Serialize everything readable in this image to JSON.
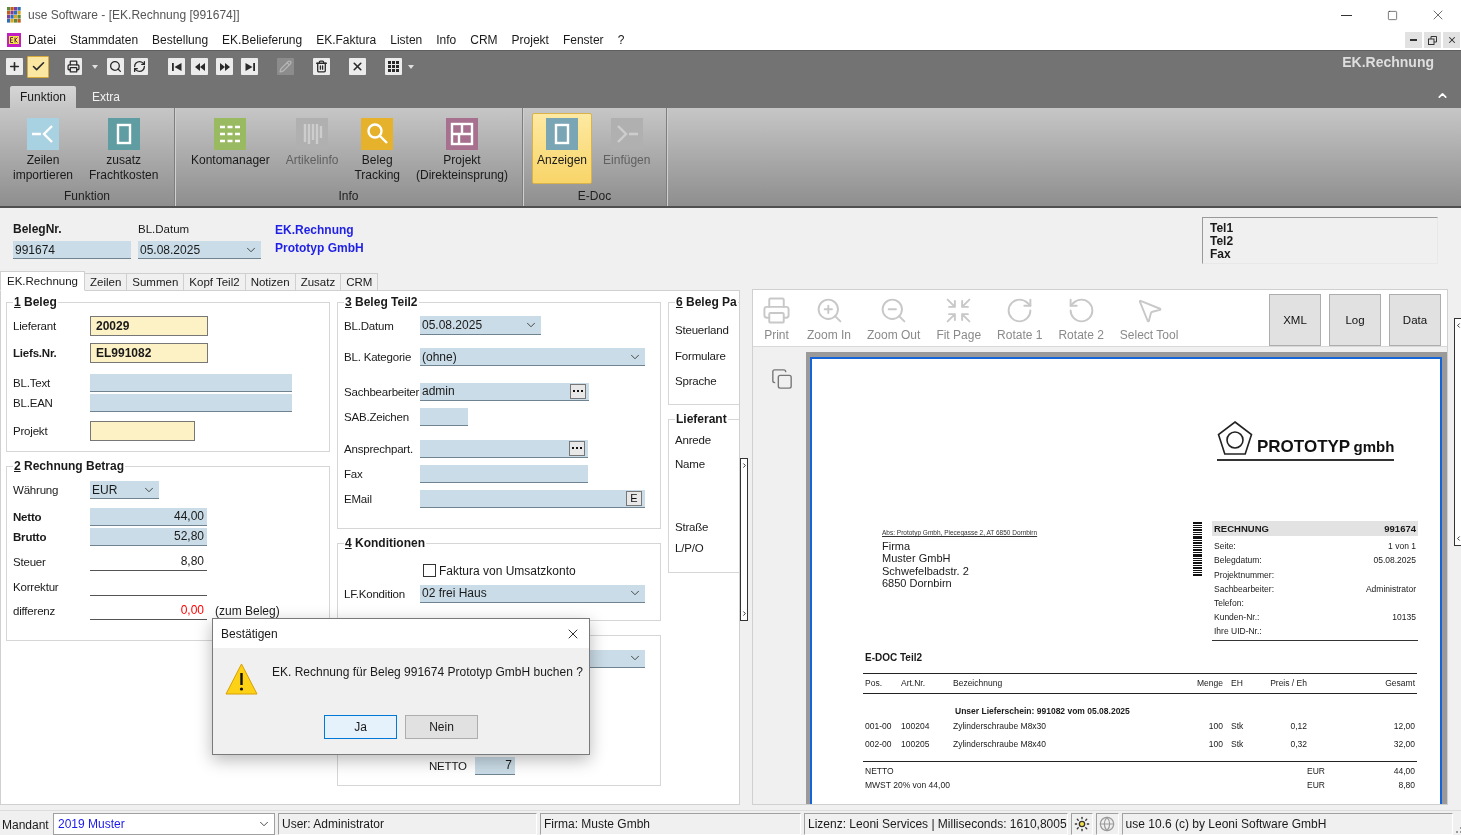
{
  "window": {
    "title": "use Software - [EK.Rechnung [991674]]"
  },
  "menu": {
    "items": [
      "Datei",
      "Stammdaten",
      "Bestellung",
      "EK.Belieferung",
      "EK.Faktura",
      "Listen",
      "Info",
      "CRM",
      "Projekt",
      "Fenster",
      "?"
    ]
  },
  "toolbar": {
    "buttons": [
      {
        "kind": "add",
        "pressed": false,
        "disabled": false
      },
      {
        "kind": "confirm",
        "pressed": true,
        "disabled": false
      },
      {
        "kind": "print",
        "pressed": false,
        "disabled": false
      },
      {
        "kind": "dropdown",
        "pressed": false,
        "disabled": false
      },
      {
        "kind": "search",
        "pressed": false,
        "disabled": false
      },
      {
        "kind": "refresh",
        "pressed": false,
        "disabled": false
      },
      {
        "kind": "first",
        "pressed": false,
        "disabled": false
      },
      {
        "kind": "previous",
        "pressed": false,
        "disabled": false
      },
      {
        "kind": "next",
        "pressed": false,
        "disabled": false
      },
      {
        "kind": "last",
        "pressed": false,
        "disabled": false
      },
      {
        "kind": "edit",
        "pressed": false,
        "disabled": true
      },
      {
        "kind": "delete",
        "pressed": false,
        "disabled": false
      },
      {
        "kind": "cancel",
        "pressed": false,
        "disabled": false
      },
      {
        "kind": "grid",
        "pressed": false,
        "disabled": false
      },
      {
        "kind": "dropdown",
        "pressed": false,
        "disabled": false
      }
    ],
    "module_title": "EK.Rechnung"
  },
  "ribbon": {
    "tabs": [
      {
        "label": "Funktion",
        "selected": true
      },
      {
        "label": "Extra",
        "selected": false
      }
    ],
    "groups": [
      {
        "label": "Funktion",
        "buttons": [
          {
            "kind": "import",
            "label": "Zeilen importieren",
            "selected": false,
            "disabled": false
          },
          {
            "kind": "freight",
            "label": "zusatz Frachtkosten",
            "selected": false,
            "disabled": false
          }
        ]
      },
      {
        "label": "Info",
        "buttons": [
          {
            "kind": "accounts",
            "label": "Kontomanager",
            "selected": false,
            "disabled": false
          },
          {
            "kind": "article",
            "label": "Artikelinfo",
            "selected": false,
            "disabled": true
          },
          {
            "kind": "tracking",
            "label": "Beleg Tracking",
            "selected": false,
            "disabled": false
          },
          {
            "kind": "project",
            "label": "Projekt (Direkteinsprung)",
            "selected": false,
            "disabled": false
          }
        ]
      },
      {
        "label": "E-Doc",
        "buttons": [
          {
            "kind": "display",
            "label": "Anzeigen",
            "selected": true,
            "disabled": false
          },
          {
            "kind": "insert",
            "label": "Einfügen",
            "selected": false,
            "disabled": true
          }
        ]
      }
    ]
  },
  "header": {
    "beleg_nr": {
      "label": "BelegNr.",
      "value": "991674"
    },
    "bl_datum": {
      "label": "BL.Datum",
      "value": "05.08.2025"
    },
    "document_type": "EK.Rechnung",
    "supplier": "Prototyp GmbH",
    "contact_labels": [
      "Tel1",
      "Tel2",
      "Fax"
    ]
  },
  "form": {
    "tabs": [
      {
        "label": "EK.Rechnung",
        "selected": true
      },
      {
        "label": "Zeilen",
        "selected": false
      },
      {
        "label": "Summen",
        "selected": false
      },
      {
        "label": "Kopf Teil2",
        "selected": false
      },
      {
        "label": "Notizen",
        "selected": false
      },
      {
        "label": "Zusatz",
        "selected": false
      },
      {
        "label": "CRM",
        "selected": false
      }
    ],
    "beleg": {
      "number": "1",
      "title": "Beleg",
      "fields": [
        {
          "kind": "required",
          "label": "Lieferant",
          "value": "20029"
        },
        {
          "kind": "required",
          "label": "Liefs.Nr.",
          "value": "EL991082"
        },
        {
          "kind": "input",
          "label": "BL.Text"
        },
        {
          "kind": "input",
          "label": "BL.EAN"
        },
        {
          "kind": "required",
          "label": "Projekt"
        }
      ]
    },
    "rechnung_betrag": {
      "number": "2",
      "title": "Rechnung Betrag",
      "fields": [
        {
          "kind": "dropdown",
          "label": "Währung",
          "value": "EUR"
        },
        {
          "kind": "input",
          "label": "Netto",
          "value": "44,00"
        },
        {
          "kind": "input",
          "label": "Brutto",
          "value": "52,80"
        },
        {
          "kind": "line",
          "label": "Steuer",
          "value": "8,80"
        },
        {
          "kind": "line",
          "label": "Korrektur"
        },
        {
          "kind": "line",
          "label": "differenz",
          "value": "0,00",
          "note": "(zum Beleg)"
        }
      ]
    },
    "beleg_teil2": {
      "number": "3",
      "title": "Beleg Teil2",
      "fields": [
        {
          "kind": "dropdown",
          "label": "BL.Datum",
          "value": "05.08.2025"
        },
        {
          "kind": "dropdown",
          "label": "BL. Kategorie",
          "value": "(ohne)"
        },
        {
          "kind": "lookup",
          "label": "Sachbearbeiter",
          "value": "admin"
        },
        {
          "kind": "input",
          "label": "SAB.Zeichen"
        },
        {
          "kind": "lookup",
          "label": "Ansprechpart."
        },
        {
          "kind": "input",
          "label": "Fax"
        },
        {
          "kind": "email",
          "label": "EMail",
          "button": "E"
        }
      ]
    },
    "konditionen": {
      "number": "4",
      "title": "Konditionen",
      "fields": [
        {
          "kind": "checkbox",
          "label": "Faktura von Umsatzkonto",
          "checked": false
        },
        {
          "kind": "dropdown",
          "label": "LF.Kondition",
          "value": "02 frei Haus"
        }
      ]
    },
    "section_5": {
      "fields": [
        {
          "kind": "dropdown"
        },
        {
          "kind": "input",
          "label": "NETTO",
          "value": "7"
        }
      ]
    },
    "beleg_parameter": {
      "number": "6",
      "title": "Beleg Pa",
      "fields": [
        {
          "label": "Steuerland"
        },
        {
          "label": "Formulare"
        },
        {
          "label": "Sprache"
        }
      ]
    },
    "lieferant": {
      "title": "Lieferant",
      "fields": [
        {
          "label": "Anrede"
        },
        {
          "label": "Name"
        },
        {
          "label": "Straße"
        },
        {
          "label": "L/P/O"
        }
      ]
    }
  },
  "preview": {
    "tools": [
      {
        "kind": "print",
        "label": "Print",
        "disabled": true
      },
      {
        "kind": "zoom_in",
        "label": "Zoom In",
        "disabled": true
      },
      {
        "kind": "zoom_out",
        "label": "Zoom Out",
        "disabled": true
      },
      {
        "kind": "fit",
        "label": "Fit Page",
        "disabled": true
      },
      {
        "kind": "rotate_cw",
        "label": "Rotate 1",
        "disabled": true
      },
      {
        "kind": "rotate_ccw",
        "label": "Rotate 2",
        "disabled": true
      },
      {
        "kind": "select",
        "label": "Select Tool",
        "disabled": true
      }
    ],
    "buttons": [
      "XML",
      "Log",
      "Data"
    ],
    "document": {
      "logo": {
        "name": "PROTOTYP",
        "suffix": "gmbh"
      },
      "sender": "Abs: Prototyp Gmbh, Piecegasse 2, AT 6850 Dornbirn",
      "address": [
        "Firma",
        "Muster GmbH",
        "Schwefelbadstr. 2",
        "6850 Dornbirn"
      ],
      "info": {
        "title": "RECHNUNG",
        "number": "991674",
        "rows": [
          {
            "label": "Seite:",
            "value": "1 von 1"
          },
          {
            "label": "Belegdatum:",
            "value": "05.08.2025"
          },
          {
            "label": "Projektnummer:"
          },
          {
            "label": "Sachbearbeiter:",
            "value": "Administrator"
          },
          {
            "label": "Telefon:"
          },
          {
            "label": "Kunden-Nr.:",
            "value": "10135"
          },
          {
            "label": "Ihre UID-Nr.:"
          }
        ]
      },
      "heading": "E-DOC Teil2",
      "table": {
        "columns": [
          "Pos.",
          "Art.Nr.",
          "Bezeichnung",
          "Menge",
          "EH",
          "Preis / Eh",
          "Gesamt"
        ],
        "group": "Unser Lieferschein: 991082 vom 05.08.2025",
        "rows": [
          [
            "001-00",
            "100204",
            "Zylinderschraube M8x30",
            "100",
            "Stk",
            "0,12",
            "12,00"
          ],
          [
            "002-00",
            "100205",
            "Zylinderschraube M8x40",
            "100",
            "Stk",
            "0,32",
            "32,00"
          ]
        ]
      },
      "totals": [
        {
          "label": "NETTO",
          "currency": "EUR",
          "amount": "44,00"
        },
        {
          "label": "MWST 20% von 44,00",
          "currency": "EUR",
          "amount": "8,80"
        }
      ]
    }
  },
  "dialog": {
    "title": "Bestätigen",
    "message": "EK. Rechnung für Beleg 991674 Prototyp GmbH buchen ?",
    "buttons": [
      {
        "label": "Ja",
        "selected": true
      },
      {
        "label": "Nein",
        "selected": false
      }
    ]
  },
  "status_bar": {
    "mandant_label": "Mandant",
    "mandant": "2019 Muster",
    "cells": [
      "User: Administrator",
      "Firma: Muste Gmbh",
      "Lizenz: Leoni Services | Milliseconds: 1610,8005"
    ],
    "version": "use 10.6 (c) by Leoni Software GmbH"
  }
}
